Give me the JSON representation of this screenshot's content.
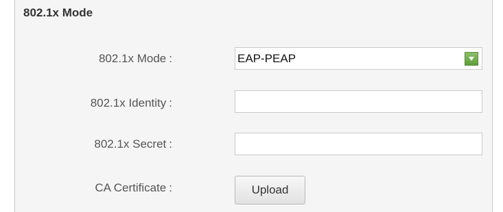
{
  "section": {
    "title": "802.1x Mode"
  },
  "fields": {
    "mode": {
      "label": "802.1x Mode",
      "colon": ":",
      "value": "EAP-PEAP"
    },
    "identity": {
      "label": "802.1x Identity",
      "colon": ":",
      "value": ""
    },
    "secret": {
      "label": "802.1x Secret",
      "colon": ":",
      "value": ""
    },
    "ca_certificate": {
      "label": "CA Certificate",
      "colon": ":",
      "button_label": "Upload"
    }
  },
  "colors": {
    "panel_background": "#f5f5f5",
    "dropdown_accent": "#6aa843"
  },
  "icons": {
    "dropdown": "chevron-down-icon"
  }
}
